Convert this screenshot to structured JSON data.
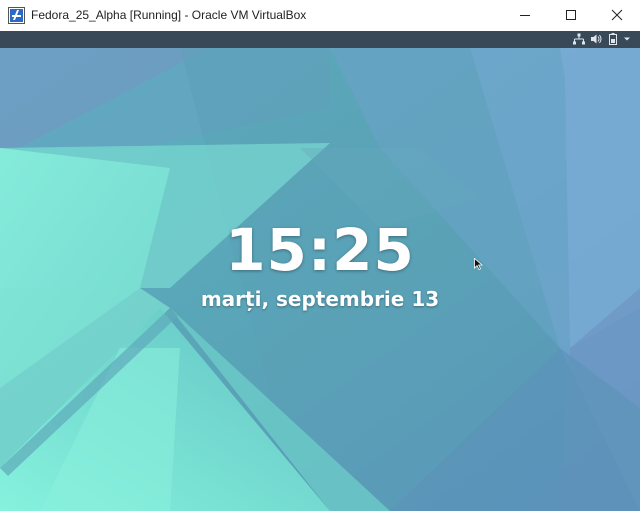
{
  "window": {
    "title": "Fedora_25_Alpha [Running] - Oracle VM VirtualBox",
    "icon": "virtualbox-icon",
    "controls": [
      "minimize-icon",
      "maximize-icon",
      "close-icon"
    ]
  },
  "statusbar": {
    "icons": [
      "network-icon",
      "volume-icon",
      "battery-icon",
      "chevron-down-icon"
    ],
    "color": "#3a4958"
  },
  "lockscreen": {
    "time": "15:25",
    "date": "marți, septembrie 13"
  },
  "colors": {
    "wallpaper_primary": "#5aa6b8",
    "wallpaper_accent": "#86f0dd",
    "wallpaper_blue": "#6f9ac8"
  }
}
